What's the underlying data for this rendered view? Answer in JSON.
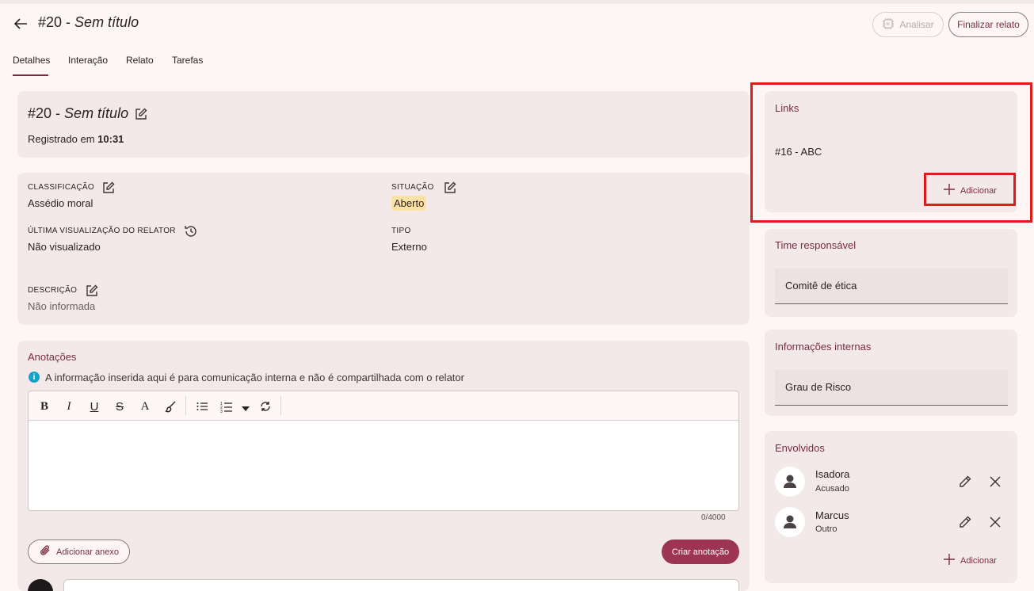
{
  "header": {
    "number": "#20",
    "separator": " - ",
    "title": "Sem título",
    "analyze_label": "Analisar",
    "finalize_label": "Finalizar relato"
  },
  "tabs": [
    "Detalhes",
    "Interação",
    "Relato",
    "Tarefas"
  ],
  "summary": {
    "number": "#20",
    "separator": " - ",
    "title": "Sem título",
    "registered_prefix": "Registrado em ",
    "registered_time": "10:31"
  },
  "details": {
    "classification_label": "CLASSIFICAÇÃO",
    "classification_value": "Assédio moral",
    "status_label": "SITUAÇÃO",
    "status_value": "Aberto",
    "last_view_label": "ÚLTIMA VISUALIZAÇÃO DO RELATOR",
    "last_view_value": "Não visualizado",
    "type_label": "TIPO",
    "type_value": "Externo",
    "description_label": "DESCRIÇÃO",
    "description_value": "Não informada"
  },
  "notes": {
    "title": "Anotações",
    "info": "A informação inserida aqui é para comunicação interna e não é compartilhada com o relator",
    "counter": "0/4000",
    "attach_label": "Adicionar anexo",
    "create_label": "Criar anotação",
    "toolbar": [
      "B",
      "I",
      "U",
      "S",
      "A"
    ]
  },
  "links": {
    "title": "Links",
    "items": [
      "#16 - ABC"
    ],
    "add_label": "Adicionar"
  },
  "team": {
    "title": "Time responsável",
    "value": "Comitê de ética"
  },
  "internal": {
    "title": "Informações internas",
    "value": "Grau de Risco"
  },
  "involved": {
    "title": "Envolvidos",
    "people": [
      {
        "name": "Isadora",
        "role": "Acusado"
      },
      {
        "name": "Marcus",
        "role": "Outro"
      }
    ],
    "add_label": "Adicionar"
  },
  "colors": {
    "accent": "#7a2b42",
    "primary_button": "#9c3553",
    "status_badge": "#fde2a7",
    "highlight": "#e01b1b"
  }
}
